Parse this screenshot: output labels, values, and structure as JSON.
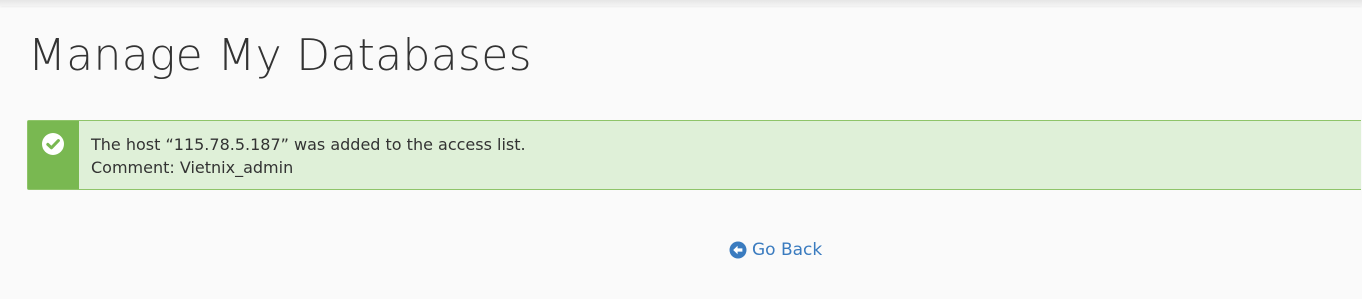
{
  "page": {
    "title": "Manage My Databases"
  },
  "alert": {
    "type": "success",
    "icon": "check-circle-icon",
    "message": "The host “115.78.5.187” was added to the access list.",
    "comment": "Comment: Vietnix_admin"
  },
  "navigation": {
    "go_back_label": "Go Back",
    "go_back_icon": "arrow-circle-left-icon"
  },
  "colors": {
    "success_background": "#dff0d8",
    "success_accent": "#79b851",
    "link": "#3a7bbf",
    "text": "#333333"
  }
}
